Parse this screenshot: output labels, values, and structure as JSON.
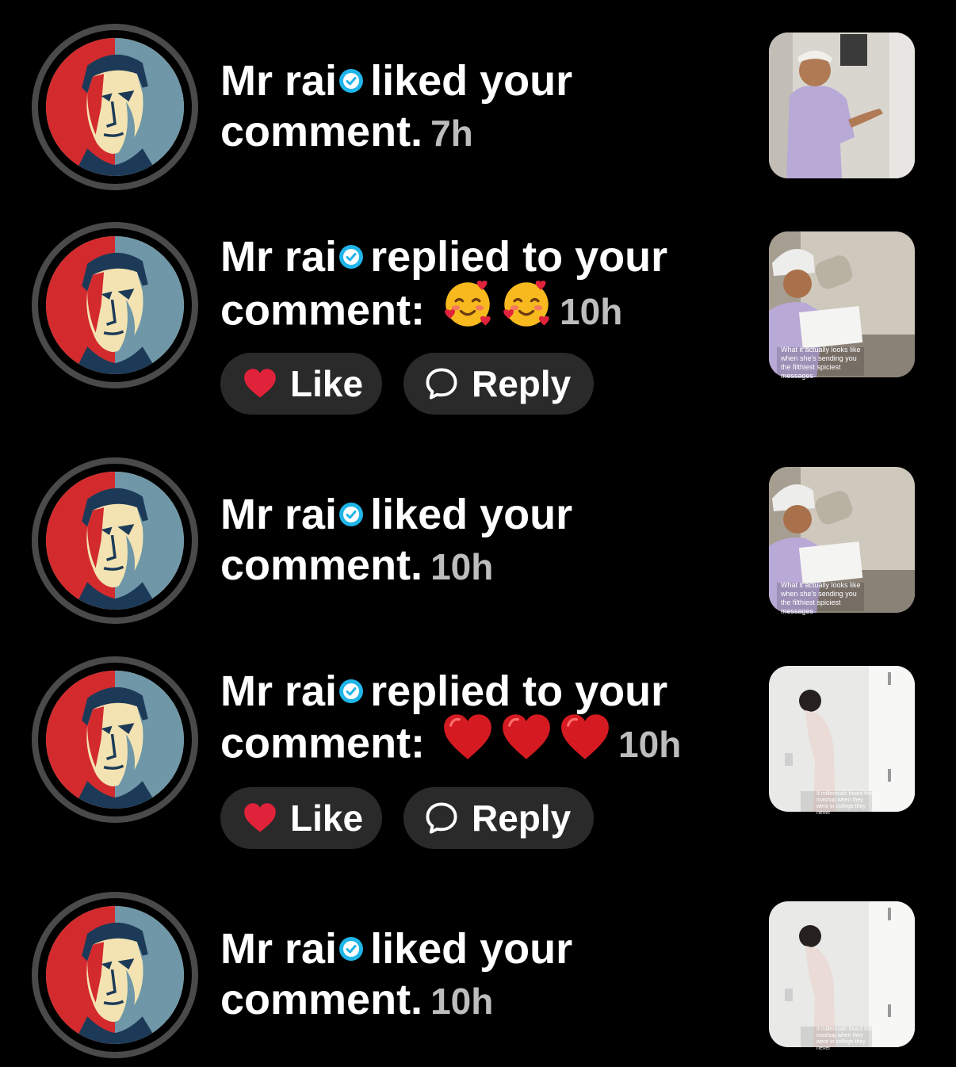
{
  "notifications": [
    {
      "user": "Mr rai",
      "action": "liked your",
      "action2": "comment.",
      "emojis": "",
      "time": "7h",
      "actions": false
    },
    {
      "user": "Mr rai",
      "action": "replied to your",
      "action2": "comment:",
      "emojis": "🥰 🥰",
      "time": "10h",
      "actions": true
    },
    {
      "user": "Mr rai",
      "action": "liked your",
      "action2": "comment.",
      "emojis": "",
      "time": "10h",
      "actions": false
    },
    {
      "user": "Mr rai",
      "action": "replied to your",
      "action2": "comment:",
      "emojis": "❤️❤️❤️",
      "time": "10h",
      "actions": true
    },
    {
      "user": "Mr rai",
      "action": "liked your",
      "action2": "comment.",
      "emojis": "",
      "time": "10h",
      "actions": false
    }
  ],
  "buttons": {
    "like_label": "Like",
    "reply_label": "Reply"
  },
  "thumb_captions": {
    "t2": "What it actually looks like when she's sending you the filthiest spiciest messages",
    "t4": "If millennials heard this mashup when they were in college they never"
  },
  "colors": {
    "background": "#000000",
    "verified": "#20b5e8",
    "heart": "#e0223b",
    "button_bg": "#2a2a2a",
    "time": "#bdbdbd"
  }
}
